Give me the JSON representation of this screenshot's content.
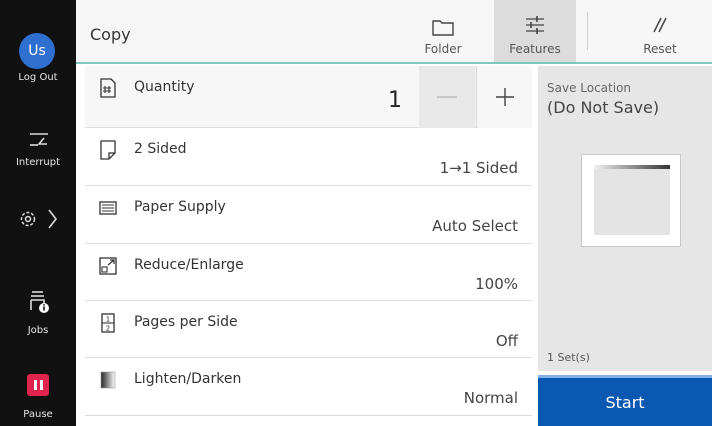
{
  "rail": {
    "avatar_initials": "Us",
    "logout_label": "Log Out",
    "interrupt_label": "Interrupt",
    "settings_icon": "gear-icon",
    "jobs_label": "Jobs",
    "pause_label": "Pause"
  },
  "header": {
    "title": "Copy",
    "folder_label": "Folder",
    "features_label": "Features",
    "reset_label": "Reset",
    "divider_color": "#7cc9b9"
  },
  "quantity": {
    "label": "Quantity",
    "value": "1",
    "minus": "—",
    "plus": "+"
  },
  "features": [
    {
      "label": "2 Sided",
      "value": "1→1 Sided"
    },
    {
      "label": "Paper Supply",
      "value": "Auto Select"
    },
    {
      "label": "Reduce/Enlarge",
      "value": "100%"
    },
    {
      "label": "Pages per Side",
      "value": "Off"
    },
    {
      "label": "Lighten/Darken",
      "value": "Normal"
    }
  ],
  "preview": {
    "save_location_label": "Save Location",
    "save_location_value": "(Do Not Save)",
    "sets": "1 Set(s)"
  },
  "start_label": "Start",
  "colors": {
    "start": "#0a58b2",
    "pause": "#e0244e",
    "avatar": "#2f6fcf"
  }
}
